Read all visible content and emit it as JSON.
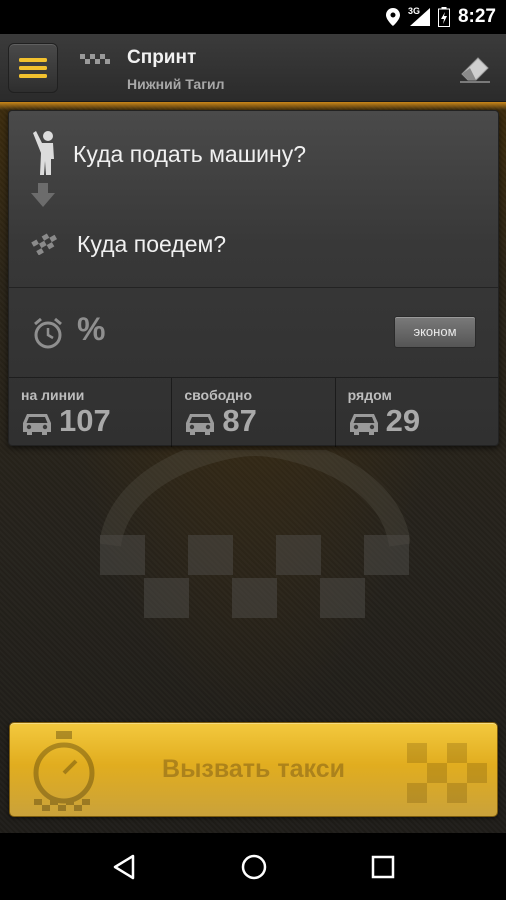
{
  "status_bar": {
    "network": "3G",
    "time": "8:27"
  },
  "app_bar": {
    "title": "Спринт",
    "subtitle": "Нижний Тагил",
    "icons": [
      "menu-icon",
      "taxi-checker-icon",
      "eraser-icon"
    ]
  },
  "order": {
    "from_placeholder": "Куда подать машину?",
    "to_placeholder": "Куда поедем?",
    "discount_symbol": "%",
    "tariff_label": "эконом"
  },
  "stats": [
    {
      "label": "на линии",
      "value": "107"
    },
    {
      "label": "свободно",
      "value": "87"
    },
    {
      "label": "рядом",
      "value": "29"
    }
  ],
  "call_button": {
    "label": "Вызвать такси"
  },
  "colors": {
    "accent": "#e1ad1f",
    "card": "#3c3c3c",
    "menu_icon": "#f2c12e"
  }
}
